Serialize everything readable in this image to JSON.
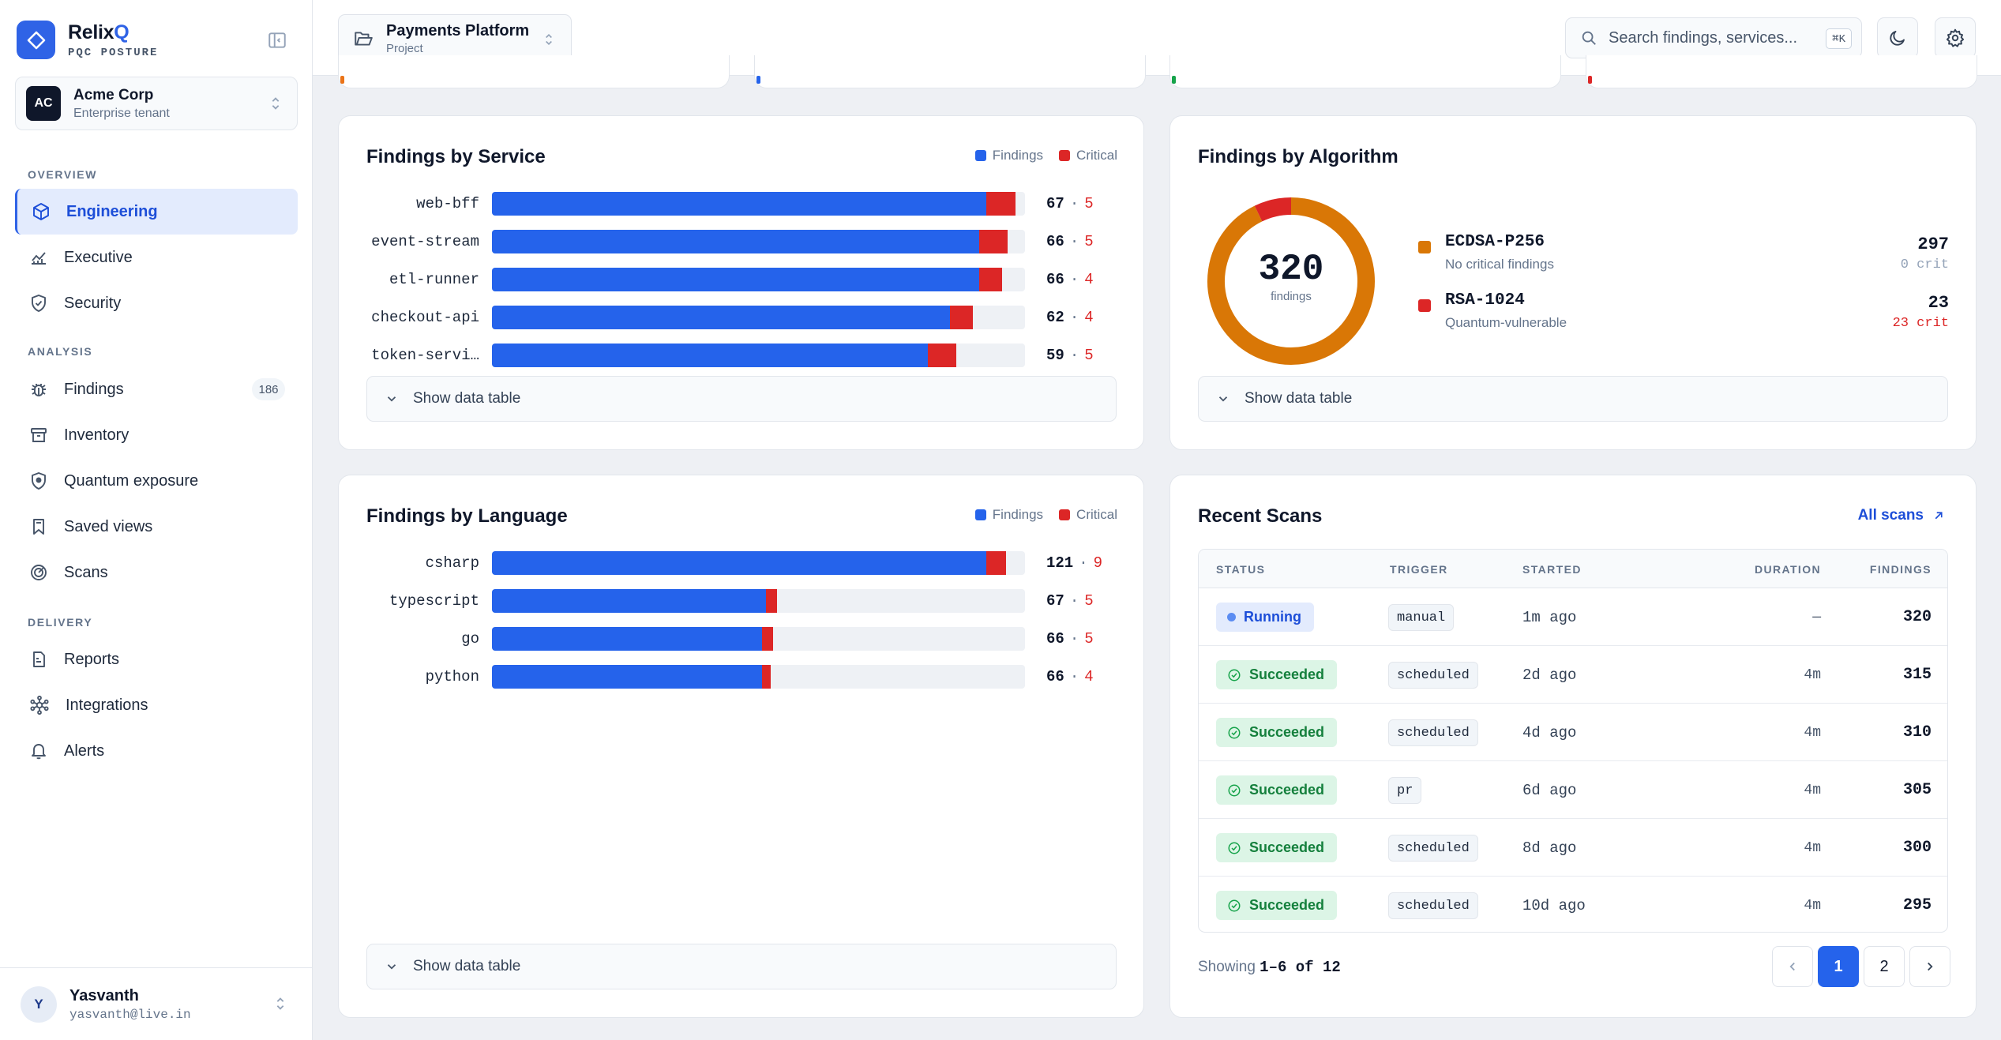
{
  "brand": {
    "name_main": "Relix",
    "name_accent": "Q",
    "subtitle": "PQC POSTURE"
  },
  "tenant": {
    "initials": "AC",
    "name": "Acme Corp",
    "subtitle": "Enterprise tenant"
  },
  "nav": {
    "sections": [
      "OVERVIEW",
      "ANALYSIS",
      "DELIVERY"
    ],
    "items": [
      {
        "label": "Engineering",
        "icon": "cube-icon",
        "active": true
      },
      {
        "label": "Executive",
        "icon": "chart-line-icon"
      },
      {
        "label": "Security",
        "icon": "shield-check-icon"
      },
      {
        "label": "Findings",
        "icon": "bug-icon",
        "count": "186"
      },
      {
        "label": "Inventory",
        "icon": "archive-icon"
      },
      {
        "label": "Quantum exposure",
        "icon": "shield-icon"
      },
      {
        "label": "Saved views",
        "icon": "bookmark-icon"
      },
      {
        "label": "Scans",
        "icon": "radar-icon"
      },
      {
        "label": "Reports",
        "icon": "report-icon"
      },
      {
        "label": "Integrations",
        "icon": "network-icon"
      },
      {
        "label": "Alerts",
        "icon": "bell-icon"
      }
    ]
  },
  "user": {
    "initial": "Y",
    "name": "Yasvanth",
    "email": "yasvanth@live.in"
  },
  "topbar": {
    "project_name": "Payments Platform",
    "project_sub": "Project",
    "search_placeholder": "Search findings, services...",
    "search_shortcut": "⌘K"
  },
  "colors": {
    "findings": "#2563eb",
    "critical": "#dc2626",
    "ecdsa": "#d97706",
    "rsa": "#dc2626",
    "accent": "#2f63e6"
  },
  "cards": {
    "by_service": {
      "title": "Findings by Service",
      "legend_findings": "Findings",
      "legend_critical": "Critical",
      "show_table": "Show data table"
    },
    "by_language": {
      "title": "Findings by Language",
      "legend_findings": "Findings",
      "legend_critical": "Critical",
      "show_table": "Show data table"
    },
    "by_algorithm": {
      "title": "Findings by Algorithm",
      "total": "320",
      "total_label": "findings",
      "show_table": "Show data table"
    },
    "recent_scans": {
      "title": "Recent Scans",
      "all_link": "All scans",
      "columns": [
        "STATUS",
        "TRIGGER",
        "STARTED",
        "DURATION",
        "FINDINGS"
      ],
      "rows": [
        {
          "status": "Running",
          "kind": "running",
          "trigger": "manual",
          "started": "1m ago",
          "duration": "—",
          "findings": "320"
        },
        {
          "status": "Succeeded",
          "kind": "ok",
          "trigger": "scheduled",
          "started": "2d ago",
          "duration": "4m",
          "findings": "315"
        },
        {
          "status": "Succeeded",
          "kind": "ok",
          "trigger": "scheduled",
          "started": "4d ago",
          "duration": "4m",
          "findings": "310"
        },
        {
          "status": "Succeeded",
          "kind": "ok",
          "trigger": "pr",
          "started": "6d ago",
          "duration": "4m",
          "findings": "305"
        },
        {
          "status": "Succeeded",
          "kind": "ok",
          "trigger": "scheduled",
          "started": "8d ago",
          "duration": "4m",
          "findings": "300"
        },
        {
          "status": "Succeeded",
          "kind": "ok",
          "trigger": "scheduled",
          "started": "10d ago",
          "duration": "4m",
          "findings": "295"
        }
      ],
      "pager_prefix": "Showing",
      "pager_range": "1–6 of 12",
      "pages": [
        "1",
        "2"
      ]
    }
  },
  "chart_data": [
    {
      "type": "bar",
      "title": "Findings by Service",
      "orientation": "horizontal",
      "stacked": true,
      "max": 67,
      "categories": [
        "web-bff",
        "event-stream",
        "etl-runner",
        "checkout-api",
        "token-servi…"
      ],
      "series": [
        {
          "name": "Findings",
          "values": [
            67,
            66,
            66,
            62,
            59
          ]
        },
        {
          "name": "Critical",
          "values": [
            5,
            5,
            4,
            4,
            5
          ]
        }
      ]
    },
    {
      "type": "pie",
      "title": "Findings by Algorithm",
      "donut": true,
      "categories": [
        "ECDSA-P256",
        "RSA-1024"
      ],
      "values": [
        297,
        23
      ],
      "descriptions": [
        "No critical findings",
        "Quantum-vulnerable"
      ],
      "critical": [
        "0 crit",
        "23 crit"
      ]
    },
    {
      "type": "bar",
      "title": "Findings by Language",
      "orientation": "horizontal",
      "stacked": true,
      "max": 121,
      "categories": [
        "csharp",
        "typescript",
        "go",
        "python"
      ],
      "series": [
        {
          "name": "Findings",
          "values": [
            121,
            67,
            66,
            66
          ]
        },
        {
          "name": "Critical",
          "values": [
            9,
            5,
            5,
            4
          ]
        }
      ]
    }
  ]
}
